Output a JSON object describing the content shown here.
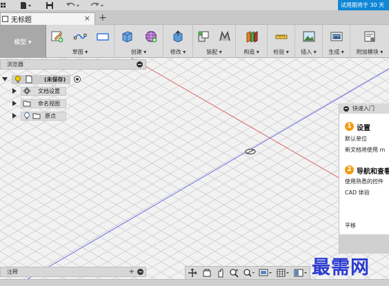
{
  "titlebar": {
    "icons": [
      "grid-menu-icon",
      "file-icon",
      "save-icon",
      "undo-icon",
      "redo-icon"
    ],
    "trial_text": "试用期将于 30 天"
  },
  "tabs": [
    {
      "label": "无标题",
      "close": "×"
    }
  ],
  "tab_add": "+",
  "ribbon": {
    "mode_label": "模型 ▾",
    "groups": [
      {
        "label": "草图 ▾",
        "icons": [
          "sketch-create-icon",
          "spline-icon",
          "rectangle-icon"
        ]
      },
      {
        "label": "创建 ▾",
        "icons": [
          "box-icon",
          "sphere-mesh-icon"
        ]
      },
      {
        "label": "修改 ▾",
        "icons": [
          "press-pull-icon"
        ]
      },
      {
        "label": "装配 ▾",
        "icons": [
          "new-component-icon",
          "joint-icon"
        ]
      },
      {
        "label": "构造 ▾",
        "icons": [
          "offset-plane-icon"
        ]
      },
      {
        "label": "检验 ▾",
        "icons": [
          "measure-icon"
        ]
      },
      {
        "label": "插入 ▾",
        "icons": [
          "insert-image-icon"
        ]
      },
      {
        "label": "生成 ▾",
        "icons": [
          "render-icon"
        ]
      },
      {
        "label": "附加模块 ▾",
        "icons": [
          "add-ins-icon"
        ]
      }
    ]
  },
  "browser": {
    "title": "浏览器",
    "root_label": "(未保存)",
    "items": [
      {
        "label": "文档设置",
        "icon": "gear-icon"
      },
      {
        "label": "命名视图",
        "icon": "folder-icon"
      },
      {
        "label": "原点",
        "icon": "lightbulb-icon"
      }
    ]
  },
  "quick_start": {
    "title": "快速入门",
    "step1_num": "1",
    "step1_title": "设置",
    "step1_line1": "默认单位",
    "step1_line2": "新文档将使用 m",
    "step2_num": "2",
    "step2_title": "导航和查看",
    "step2_line1": "使用熟悉的控件",
    "step2_line2": "CAD 体验",
    "pan_label": "平移"
  },
  "comments": {
    "title": "注释",
    "add": "+"
  },
  "navbar": {
    "icons": [
      "orbit-icon",
      "look-at-icon",
      "pan-icon",
      "zoom-icon",
      "zoom-window-icon",
      "display-settings-icon",
      "grid-icon",
      "viewports-icon"
    ]
  },
  "watermark": "最需网",
  "colors": {
    "trial_bg": "#0f87d6",
    "grid_red_axis": "#e05050",
    "grid_blue_axis": "#5a5ae6",
    "step_badge": "#f39c12",
    "watermark": "#2a3bd1"
  }
}
